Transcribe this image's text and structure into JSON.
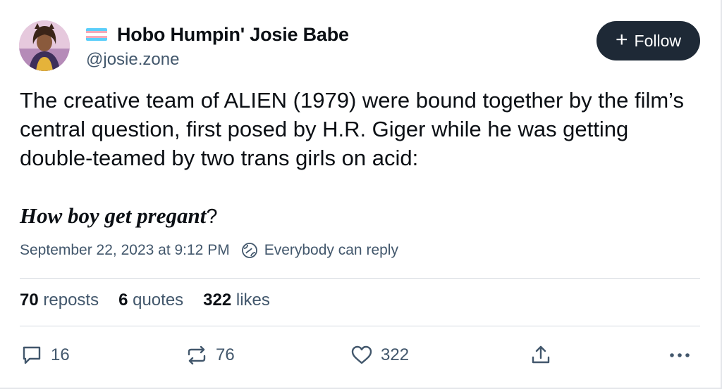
{
  "author": {
    "display_name": "Hobo Humpin' Josie Babe",
    "handle": "@josie.zone",
    "flag_colors": [
      "#5BCEFA",
      "#F5A9B8",
      "#FFFFFF",
      "#F5A9B8",
      "#5BCEFA"
    ]
  },
  "follow_button": {
    "icon": "plus-icon",
    "label": "Follow"
  },
  "post": {
    "text": "The creative team of ALIEN (1979) were bound together by the film’s central question, first posed by H.R. Giger while he was getting double-teamed by two trans girls on acid:",
    "emphasis_text": "How boy get pregant",
    "emphasis_suffix": "?"
  },
  "meta": {
    "timestamp": "September 22, 2023 at 9:12 PM",
    "reply_icon": "globe-icon",
    "reply_setting": "Everybody can reply"
  },
  "stats": {
    "reposts_count": "70",
    "reposts_label": "reposts",
    "quotes_count": "6",
    "quotes_label": "quotes",
    "likes_count": "322",
    "likes_label": "likes"
  },
  "actions": {
    "reply": {
      "icon": "reply-icon",
      "count": "16"
    },
    "repost": {
      "icon": "repost-icon",
      "count": "76"
    },
    "like": {
      "icon": "heart-icon",
      "count": "322"
    },
    "share": {
      "icon": "share-icon"
    },
    "more": {
      "icon": "more-icon"
    }
  },
  "colors": {
    "text": "#0b0f14",
    "muted": "#42576c",
    "follow_bg": "#1e2936",
    "divider": "#d4d9df"
  }
}
